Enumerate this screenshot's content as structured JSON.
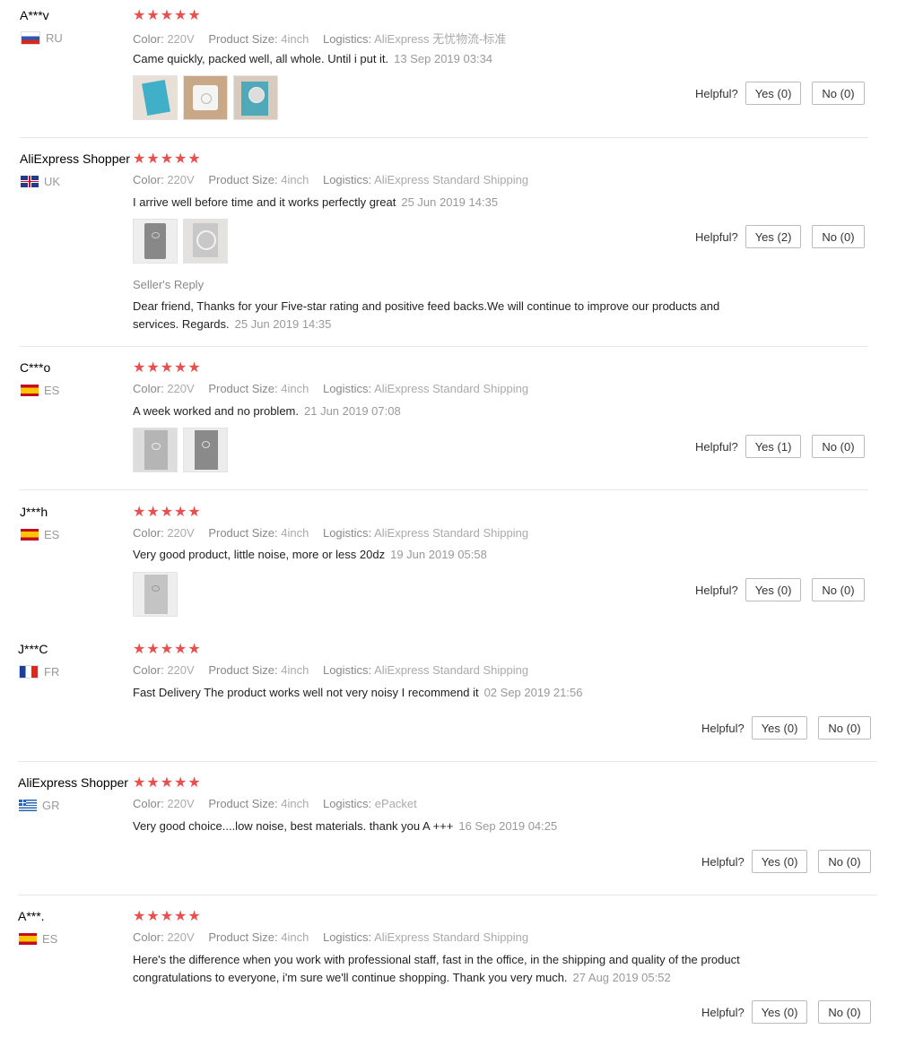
{
  "labels": {
    "color": "Color:",
    "size": "Product Size:",
    "logistics": "Logistics:",
    "helpful": "Helpful?"
  },
  "reviews": [
    {
      "name": "A***v",
      "country": "RU",
      "flag": "ru",
      "stars": "★★★★★",
      "color": "220V",
      "size": "4inch",
      "logistics": "AliExpress 无忧物流-标准",
      "text": "Came quickly, packed well, all whole. Until i put it.",
      "date": "13 Sep 2019 03:34",
      "yes": "Yes (0)",
      "no": "No (0)",
      "photos": 3
    },
    {
      "name": "AliExpress Shopper",
      "country": "UK",
      "flag": "uk",
      "stars": "★★★★★",
      "color": "220V",
      "size": "4inch",
      "logistics": "AliExpress Standard Shipping",
      "text": "I arrive well before time and it works perfectly great",
      "date": "25 Jun 2019 14:35",
      "yes": "Yes (2)",
      "no": "No (0)",
      "photos": 2,
      "reply_title": "Seller's Reply",
      "reply_text": "Dear friend, Thanks for your Five-star rating and positive feed backs.We will continue to improve our products and services. Regards.",
      "reply_date": "25 Jun 2019 14:35"
    },
    {
      "name": "C***o",
      "country": "ES",
      "flag": "es",
      "stars": "★★★★★",
      "color": "220V",
      "size": "4inch",
      "logistics": "AliExpress Standard Shipping",
      "text": "A week worked and no problem.",
      "date": "21 Jun 2019 07:08",
      "yes": "Yes (1)",
      "no": "No (0)",
      "photos": 2
    },
    {
      "name": "J***h",
      "country": "ES",
      "flag": "es",
      "stars": "★★★★★",
      "color": "220V",
      "size": "4inch",
      "logistics": "AliExpress Standard Shipping",
      "text": "Very good product, little noise, more or less 20dz",
      "date": "19 Jun 2019 05:58",
      "yes": "Yes (0)",
      "no": "No (0)",
      "photos": 1
    },
    {
      "name": "J***C",
      "country": "FR",
      "flag": "fr",
      "stars": "★★★★★",
      "color": "220V",
      "size": "4inch",
      "logistics": "AliExpress Standard Shipping",
      "text": "Fast Delivery The product works well not very noisy I recommend it",
      "date": "02 Sep 2019 21:56",
      "yes": "Yes (0)",
      "no": "No (0)",
      "photos": 0
    },
    {
      "name": "AliExpress Shopper",
      "country": "GR",
      "flag": "gr",
      "stars": "★★★★★",
      "color": "220V",
      "size": "4inch",
      "logistics": "ePacket",
      "text": "Very good choice....low noise, best materials. thank you A +++",
      "date": "16 Sep 2019 04:25",
      "yes": "Yes (0)",
      "no": "No (0)",
      "photos": 0
    },
    {
      "name": "A***.",
      "country": "ES",
      "flag": "es",
      "stars": "★★★★★",
      "color": "220V",
      "size": "4inch",
      "logistics": "AliExpress Standard Shipping",
      "text": "Here's the difference when you work with professional staff, fast in the office, in the shipping and quality of the product congratulations to everyone, i'm sure we'll continue shopping. Thank you very much.",
      "date": "27 Aug 2019 05:52",
      "yes": "Yes (0)",
      "no": "No (0)",
      "photos": 0
    }
  ]
}
